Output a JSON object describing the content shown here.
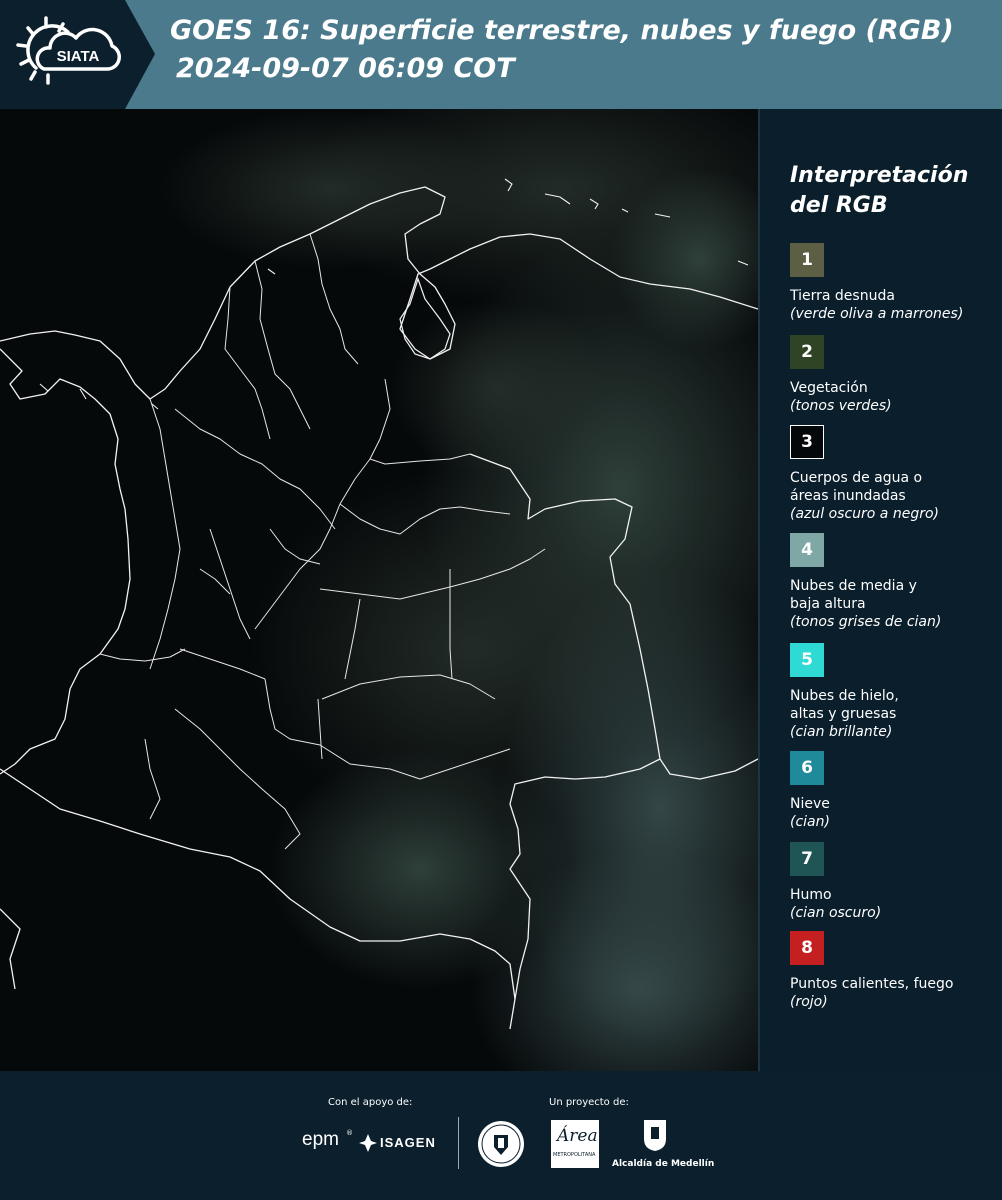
{
  "header": {
    "logo_text": "SIATA",
    "title": "GOES 16: Superficie terrestre, nubes y fuego (RGB)",
    "timestamp": "2024-09-07 06:09 COT"
  },
  "legend": {
    "title_line1": "Interpretación",
    "title_line2": "del RGB",
    "items": [
      {
        "number": "1",
        "label": "Tierra desnuda",
        "sublabel": "(verde oliva a marrones)",
        "color": "#5d5f45"
      },
      {
        "number": "2",
        "label": "Vegetación",
        "sublabel": "(tonos verdes)",
        "color": "#2e4424"
      },
      {
        "number": "3",
        "label": "Cuerpos de agua o áreas inundadas",
        "sublabel": "(azul oscuro a negro)",
        "color": "#05080a"
      },
      {
        "number": "4",
        "label": "Nubes de media y baja altura",
        "sublabel": "(tonos grises de cian)",
        "color": "#7fa7a6"
      },
      {
        "number": "5",
        "label": "Nubes de hielo, altas y gruesas",
        "sublabel": "(cian brillante)",
        "color": "#2edad3"
      },
      {
        "number": "6",
        "label": "Nieve",
        "sublabel": "(cian)",
        "color": "#1e8a9a"
      },
      {
        "number": "7",
        "label": "Humo",
        "sublabel": "(cian oscuro)",
        "color": "#1f5554"
      },
      {
        "number": "8",
        "label": "Puntos calientes, fuego",
        "sublabel": "(rojo)",
        "color": "#c42021"
      }
    ]
  },
  "footer": {
    "support_caption": "Con el apoyo de:",
    "project_caption": "Un proyecto de:",
    "sponsor_epm": "epm",
    "sponsor_isagen": "ISAGEN",
    "area_metropolitana_name": "Área",
    "area_metropolitana_sub": "METROPOLITANA",
    "alcaldia": "Alcaldía de Medellín"
  }
}
